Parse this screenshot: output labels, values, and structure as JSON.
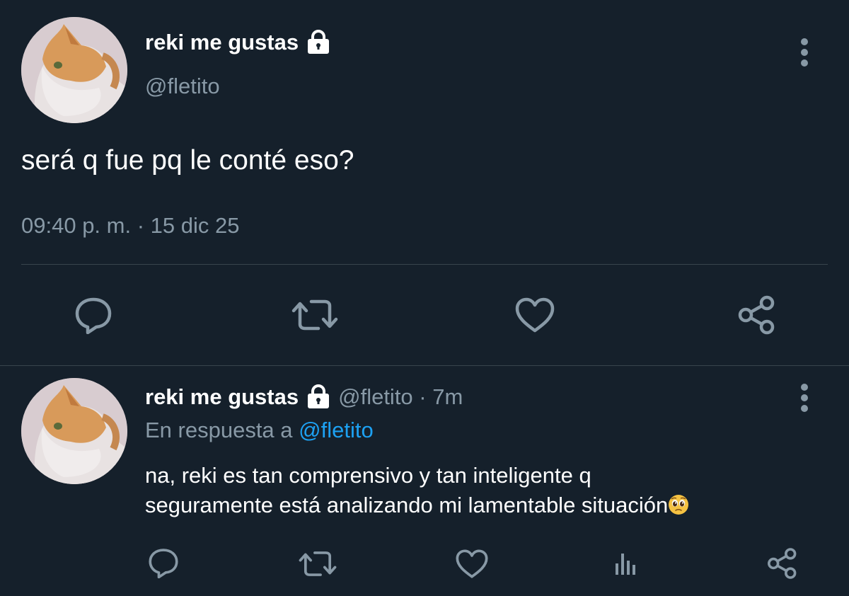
{
  "main_tweet": {
    "display_name": "reki me gustas",
    "handle": "@fletito",
    "text": "será q fue pq le conté eso?",
    "timestamp": "09:40 p. m. · 15 dic 25",
    "actions": {
      "reply_icon": "speech-bubble-icon",
      "retweet_icon": "retweet-icon",
      "like_icon": "heart-icon",
      "share_icon": "share-icon"
    }
  },
  "reply_tweet": {
    "display_name": "reki me gustas",
    "handle_time": "@fletito · 7m",
    "in_reply_prefix": "En respuesta a ",
    "in_reply_handle": "@fletito",
    "text_line1": "na, reki es tan comprensivo y tan inteligente q",
    "text_line2": "seguramente está analizando mi lamentable situación",
    "emoji": "pleading-face-emoji",
    "actions": {
      "reply_icon": "speech-bubble-icon",
      "retweet_icon": "retweet-icon",
      "like_icon": "heart-icon",
      "analytics_icon": "bar-chart-icon",
      "share_icon": "share-icon"
    }
  },
  "colors": {
    "background": "#15202b",
    "text": "#ffffff",
    "secondary_text": "#8899a6",
    "link": "#1da1f2",
    "divider": "#38444d"
  }
}
